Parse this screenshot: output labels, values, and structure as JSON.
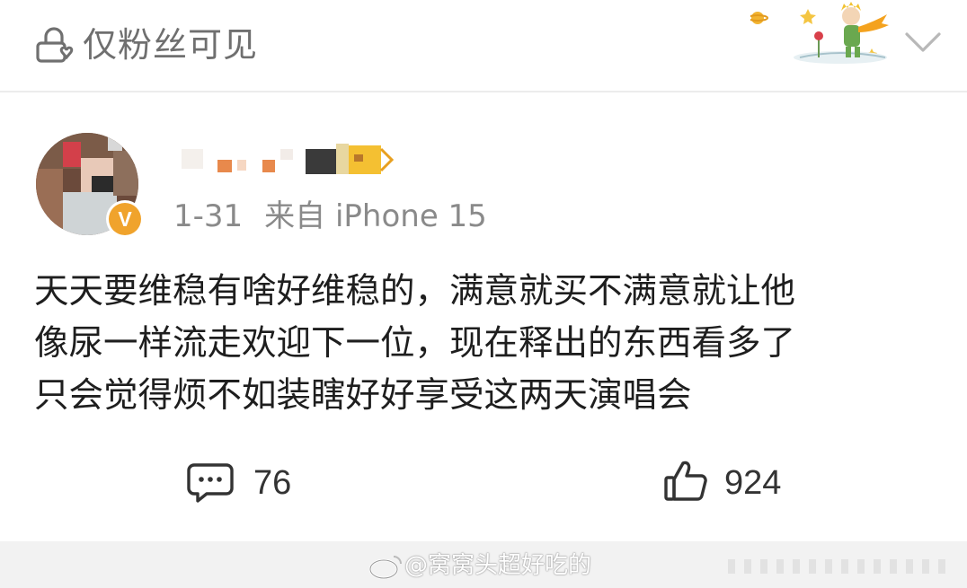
{
  "header": {
    "visibility_label": "仅粉丝可见",
    "icons": {
      "visibility": "lock-people-icon",
      "decoration": "little-prince-illustration",
      "collapse": "chevron-down-icon"
    }
  },
  "post": {
    "author": {
      "avatar": "avatar",
      "verified_badge": "V",
      "name_obscured": true
    },
    "date": "1-31",
    "source": "来自 iPhone 15",
    "lines": [
      "天天要维稳有啥好维稳的，满意就买不满意就让他",
      "像尿一样流走欢迎下一位，现在释出的东西看多了",
      "只会觉得烦不如装瞎好好享受这两天演唱会"
    ]
  },
  "actions": {
    "comments": {
      "icon": "comment-icon",
      "count": "76"
    },
    "likes": {
      "icon": "thumbs-up-icon",
      "count": "924"
    }
  },
  "watermark": "@窝窝头超好吃的",
  "colors": {
    "accent_badge": "#f0a32c",
    "muted_text": "#8a8a8a",
    "divider": "#ececec"
  }
}
